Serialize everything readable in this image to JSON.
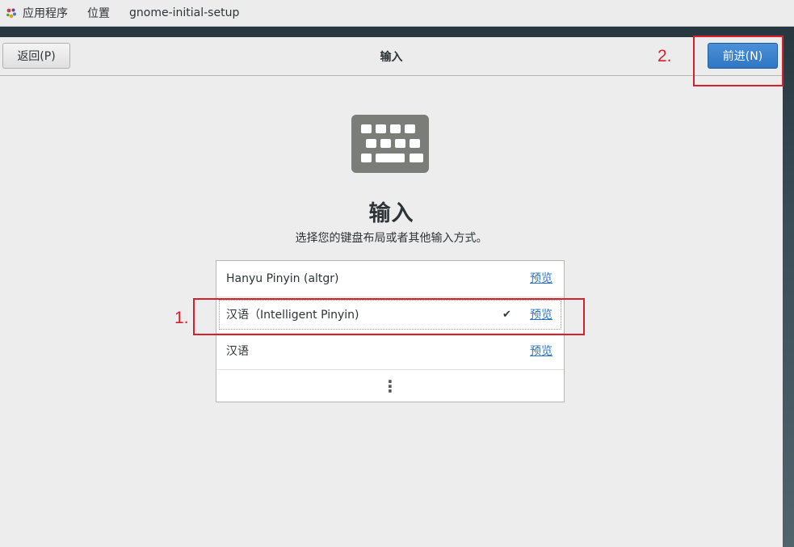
{
  "top_panel": {
    "apps_label": "应用程序",
    "places_label": "位置",
    "window_app_label": "gnome-initial-setup"
  },
  "header": {
    "back_label": "返回(P)",
    "title": "输入",
    "next_label": "前进(N)"
  },
  "main": {
    "title": "输入",
    "subtitle": "选择您的键盘布局或者其他输入方式。",
    "icon": "keyboard-icon"
  },
  "input_sources": [
    {
      "label": "Hanyu Pinyin (altgr)",
      "preview_label": "预览",
      "selected": false
    },
    {
      "label": "汉语（Intelligent Pinyin)",
      "preview_label": "预览",
      "selected": true
    },
    {
      "label": "汉语",
      "preview_label": "预览",
      "selected": false
    }
  ],
  "more_icon": "vertical-ellipsis-icon",
  "annotations": {
    "step1": "1.",
    "step2": "2."
  },
  "colors": {
    "accent": "#2f76c4",
    "link": "#2a76c6",
    "annotation": "#d9202a"
  }
}
